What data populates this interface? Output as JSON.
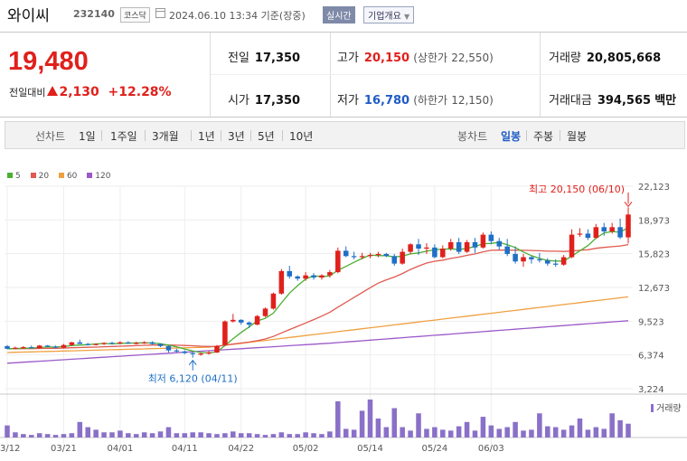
{
  "header": {
    "stock_name": "와이씨",
    "stock_code": "232140",
    "market_badge": "코스닥",
    "timestamp": "2024.06.10 13:34  기준(장중)",
    "realtime_button": "실시간",
    "company_overview_button": "기업개요",
    "dropdown_glyph": "▼"
  },
  "quote": {
    "price": "19,480",
    "change_label": "전일대비",
    "change_amount": "2,130",
    "change_pct": "+12.28%",
    "prev_close_label": "전일",
    "prev_close": "17,350",
    "open_label": "시가",
    "open": "17,350",
    "high_label": "고가",
    "high": "20,150",
    "upper_limit_label": "(상한가",
    "upper_limit": "22,550)",
    "low_label": "저가",
    "low": "16,780",
    "lower_limit_label": "(하한가",
    "lower_limit": "12,150)",
    "volume_label": "거래량",
    "volume": "20,805,668",
    "value_label": "거래대금",
    "value": "394,565",
    "value_unit": "백만"
  },
  "period_bar": {
    "line_chart_label": "선차트",
    "line_periods": [
      "1일",
      "1주일",
      "3개월",
      "1년",
      "3년",
      "5년",
      "10년"
    ],
    "candle_label": "봉차트",
    "candle_periods": [
      "일봉",
      "주봉",
      "월봉"
    ],
    "active_candle": "일봉"
  },
  "colors": {
    "up": "#e0201c",
    "down": "#1f6fc6",
    "ma5": "#4caf32",
    "ma20": "#e05a50",
    "ma60": "#f0a040",
    "ma120": "#9b59c8",
    "volume": "#8a70c8"
  },
  "chart_data": {
    "type": "candlestick",
    "legend": [
      "5",
      "20",
      "60",
      "120"
    ],
    "y_ticks": [
      "22,123",
      "18,973",
      "15,823",
      "12,673",
      "9,523",
      "6,374",
      "3,224"
    ],
    "y_tick_values": [
      22123,
      18973,
      15823,
      12673,
      9523,
      6374,
      3224
    ],
    "x_ticks": [
      "03/12",
      "03/21",
      "04/01",
      "04/11",
      "04/22",
      "05/02",
      "05/14",
      "05/24",
      "06/03"
    ],
    "x_tick_index": [
      0,
      7,
      14,
      22,
      29,
      37,
      45,
      53,
      60
    ],
    "high_annotation": "최고 20,150 (06/10)",
    "low_annotation": "최저 6,120 (04/11)",
    "volume_label": "거래량",
    "candles": [
      [
        7200,
        7300,
        6900,
        6950
      ],
      [
        6950,
        7150,
        6900,
        7050
      ],
      [
        7050,
        7200,
        6950,
        7100
      ],
      [
        7100,
        7250,
        7000,
        7000
      ],
      [
        7000,
        7300,
        6950,
        7250
      ],
      [
        7250,
        7300,
        7100,
        7150
      ],
      [
        7150,
        7250,
        7000,
        7050
      ],
      [
        7050,
        7400,
        7000,
        7300
      ],
      [
        7300,
        7600,
        7200,
        7550
      ],
      [
        7550,
        7800,
        7450,
        7400
      ],
      [
        7400,
        7500,
        7250,
        7350
      ],
      [
        7350,
        7450,
        7250,
        7400
      ],
      [
        7400,
        7550,
        7300,
        7500
      ],
      [
        7500,
        7600,
        7350,
        7450
      ],
      [
        7450,
        7650,
        7350,
        7550
      ],
      [
        7550,
        7650,
        7400,
        7450
      ],
      [
        7450,
        7600,
        7350,
        7500
      ],
      [
        7500,
        7650,
        7400,
        7550
      ],
      [
        7550,
        7650,
        7350,
        7400
      ],
      [
        7400,
        7450,
        7100,
        7200
      ],
      [
        7200,
        7250,
        6600,
        6800
      ],
      [
        6800,
        6950,
        6600,
        6700
      ],
      [
        6700,
        6800,
        6450,
        6550
      ],
      [
        6550,
        6650,
        6120,
        6450
      ],
      [
        6450,
        6600,
        6300,
        6500
      ],
      [
        6500,
        6750,
        6400,
        6600
      ],
      [
        6600,
        7300,
        6550,
        7200
      ],
      [
        7300,
        9600,
        7200,
        9500
      ],
      [
        9500,
        10200,
        9400,
        9650
      ],
      [
        9650,
        9700,
        9200,
        9400
      ],
      [
        9400,
        9500,
        8900,
        9200
      ],
      [
        9200,
        10100,
        9150,
        10000
      ],
      [
        10000,
        10800,
        9900,
        10700
      ],
      [
        10700,
        12200,
        10600,
        12100
      ],
      [
        12100,
        14400,
        12000,
        14200
      ],
      [
        14200,
        14700,
        13500,
        13700
      ],
      [
        13700,
        13800,
        13300,
        13500
      ],
      [
        13500,
        14100,
        13300,
        13800
      ],
      [
        13800,
        14000,
        13400,
        13600
      ],
      [
        13600,
        13900,
        13400,
        13800
      ],
      [
        13800,
        14300,
        13600,
        14100
      ],
      [
        14100,
        16400,
        14000,
        16100
      ],
      [
        16100,
        16500,
        15500,
        15600
      ],
      [
        15600,
        16000,
        15300,
        15500
      ],
      [
        15500,
        15900,
        15300,
        15600
      ],
      [
        15600,
        15900,
        15400,
        15700
      ],
      [
        15700,
        16000,
        15500,
        15800
      ],
      [
        15800,
        15900,
        15500,
        15600
      ],
      [
        15600,
        15800,
        14700,
        14900
      ],
      [
        14900,
        16300,
        14800,
        16000
      ],
      [
        16000,
        16800,
        15800,
        16700
      ],
      [
        16700,
        17200,
        15700,
        16300
      ],
      [
        16300,
        16800,
        15800,
        16400
      ],
      [
        16400,
        16700,
        15400,
        15500
      ],
      [
        15500,
        16600,
        15400,
        16300
      ],
      [
        16300,
        17200,
        16100,
        16900
      ],
      [
        16900,
        17300,
        15800,
        16000
      ],
      [
        16000,
        17100,
        15900,
        16900
      ],
      [
        16900,
        17300,
        15900,
        16400
      ],
      [
        16400,
        17800,
        16300,
        17600
      ],
      [
        17600,
        17900,
        16700,
        17000
      ],
      [
        17000,
        17300,
        16200,
        16500
      ],
      [
        16500,
        17200,
        15600,
        15800
      ],
      [
        15800,
        16500,
        14900,
        15100
      ],
      [
        15100,
        15800,
        14600,
        15500
      ],
      [
        15500,
        15600,
        14900,
        15300
      ],
      [
        15300,
        15900,
        15000,
        15200
      ],
      [
        15200,
        15400,
        14700,
        14900
      ],
      [
        14900,
        15300,
        14600,
        14800
      ],
      [
        14800,
        15700,
        14700,
        15500
      ],
      [
        15500,
        18100,
        15400,
        17600
      ],
      [
        17600,
        18200,
        17400,
        17700
      ],
      [
        17700,
        18100,
        17100,
        17300
      ],
      [
        17300,
        18600,
        17200,
        18300
      ],
      [
        18300,
        18700,
        17500,
        17900
      ],
      [
        17900,
        18700,
        17700,
        18300
      ],
      [
        18300,
        19100,
        17200,
        17350
      ],
      [
        17350,
        20150,
        16780,
        19480
      ]
    ],
    "volumes": [
      14,
      6,
      4,
      3,
      5,
      4,
      3,
      4,
      5,
      18,
      12,
      9,
      6,
      6,
      8,
      5,
      4,
      6,
      5,
      7,
      12,
      5,
      5,
      6,
      6,
      5,
      4,
      5,
      7,
      5,
      5,
      4,
      3,
      4,
      6,
      4,
      4,
      6,
      5,
      4,
      7,
      42,
      10,
      9,
      31,
      44,
      22,
      12,
      34,
      12,
      8,
      28,
      10,
      12,
      9,
      8,
      13,
      18,
      8,
      24,
      14,
      10,
      12,
      18,
      8,
      9,
      28,
      13,
      12,
      9,
      14,
      22,
      9,
      12,
      10,
      28,
      20,
      16
    ]
  }
}
